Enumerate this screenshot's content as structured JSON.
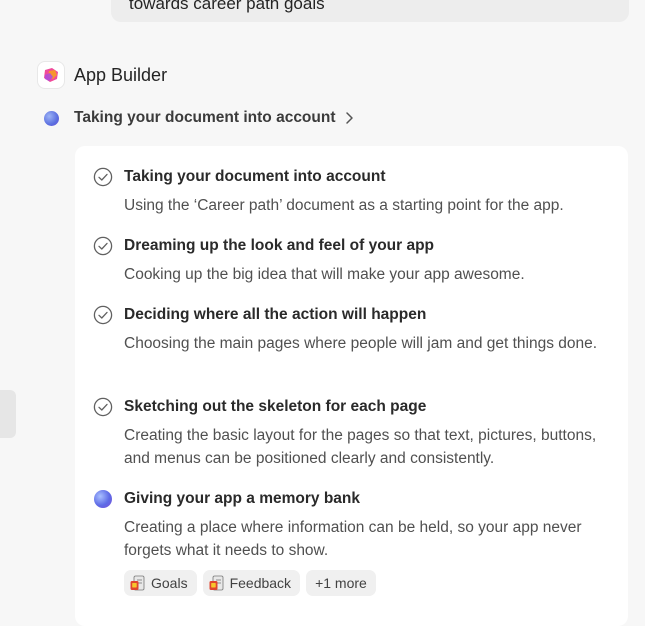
{
  "user_message": {
    "text": "towards career path goals"
  },
  "agent": {
    "name": "App Builder"
  },
  "status": {
    "text": "Taking your document into account"
  },
  "steps": [
    {
      "state": "done",
      "title": "Taking your document into account",
      "description": "Using the ‘Career path’ document as a starting point for the app."
    },
    {
      "state": "done",
      "title": "Dreaming up the look and feel of your app",
      "description": "Cooking up the big idea that will make your app awesome."
    },
    {
      "state": "done",
      "title": "Deciding where all the action will happen",
      "description": "Choosing the main pages where people will jam and get things done."
    },
    {
      "state": "done",
      "title": "Sketching out the skeleton for each page",
      "description": "Creating the basic layout for the pages so that text, pictures, buttons, and menus can be positioned clearly and consistently."
    },
    {
      "state": "in-progress",
      "title": "Giving your app a memory bank",
      "description": "Creating a place where information can be held, so your app never forgets what it needs to show."
    }
  ],
  "references": {
    "items": [
      "Goals",
      "Feedback"
    ],
    "more_label": "+1 more"
  },
  "colors": {
    "accent": "#5b6fe0",
    "card": "#ffffff",
    "background": "#f7f7f7"
  }
}
